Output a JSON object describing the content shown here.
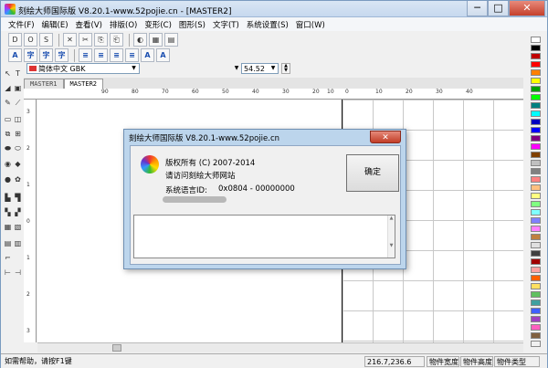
{
  "window": {
    "title": "刻绘大师国际版 V8.20.1-www.52pojie.cn - [MASTER2]",
    "min": "─",
    "max": "□",
    "close": "✕"
  },
  "menu": [
    "文件(F)",
    "编辑(E)",
    "查看(V)",
    "排版(O)",
    "变形(C)",
    "图形(S)",
    "文字(T)",
    "系统设置(S)",
    "窗口(W)"
  ],
  "toolbar1": [
    "D",
    "O",
    "S",
    "✕",
    "✂",
    "⎘",
    "⎗",
    "◐",
    "▦",
    "▤"
  ],
  "toolbar2": [
    "A",
    "字",
    "字",
    "字",
    "≡",
    "≡",
    "≡",
    "≡",
    "A",
    "A"
  ],
  "font": {
    "name": "简体中文 GBK",
    "size": "54.52"
  },
  "tabs": [
    "MASTER1",
    "MASTER2"
  ],
  "ruler_h": [
    "90",
    "80",
    "70",
    "60",
    "50",
    "40",
    "30",
    "20",
    "10",
    "0",
    "10",
    "20",
    "30",
    "40"
  ],
  "ruler_v": [
    "3",
    "2",
    "1",
    "0",
    "1",
    "2",
    "3"
  ],
  "palette": [
    "#ffffff",
    "#000000",
    "#c00000",
    "#ff0000",
    "#ff8000",
    "#ffff00",
    "#00a000",
    "#00ff00",
    "#008080",
    "#00ffff",
    "#0000c0",
    "#0000ff",
    "#800080",
    "#ff00ff",
    "#804000",
    "#c0c0c0",
    "#808080",
    "#ff8080",
    "#ffc080",
    "#ffff80",
    "#80ff80",
    "#80ffff",
    "#8080ff",
    "#ff80ff",
    "#c08040",
    "#e0e0e0",
    "#404040",
    "#a00000",
    "#ffa0a0",
    "#ff6000",
    "#ffe060",
    "#60c060",
    "#40a0a0",
    "#4060ff",
    "#a040c0",
    "#ff60c0",
    "#806040",
    "#f0f0f0"
  ],
  "status": {
    "help": "如需帮助，请按F1键",
    "coords": "216.7,236.6",
    "width": "物件宽度",
    "height": "物件高度",
    "type": "物件类型"
  },
  "dialog": {
    "title": "刻绘大师国际版 V8.20.1-www.52pojie.cn",
    "close": "✕",
    "copyright": "版权所有 (C) 2007-2014",
    "visit": "请访问刻绘大师网站",
    "langid_label": "系统语言ID:",
    "langid_value": "0x0804 - 00000000",
    "ok": "确定",
    "scroll_up": "▲",
    "scroll_down": "▼"
  },
  "colors": {
    "accent": "#bcd5ec",
    "close": "#c23d27"
  }
}
